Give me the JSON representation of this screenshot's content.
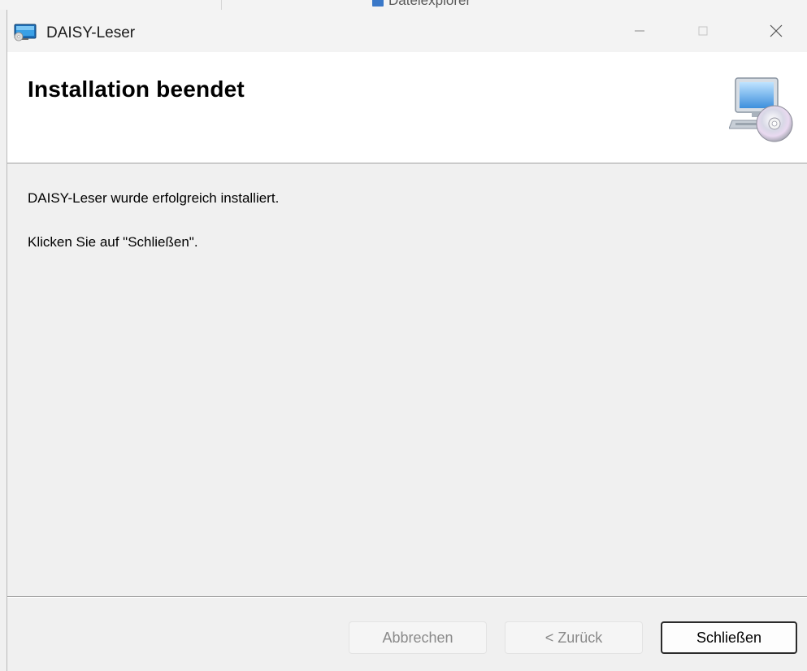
{
  "background_window": {
    "title_fragment": "Dateiexplorer"
  },
  "window": {
    "title": "DAISY-Leser",
    "controls": {
      "minimize_icon": "minimize-icon",
      "maximize_icon": "maximize-icon",
      "close_icon": "close-icon"
    }
  },
  "header": {
    "title": "Installation beendet",
    "icon": "computer-cd-icon"
  },
  "body": {
    "lines": [
      "DAISY-Leser wurde erfolgreich installiert.",
      "Klicken Sie auf \"Schließen\"."
    ]
  },
  "buttons": {
    "cancel_label": "Abbrechen",
    "back_label": "< Zurück",
    "close_label": "Schließen"
  },
  "colors": {
    "dialog_bg": "#f0f0f0",
    "header_bg": "#ffffff",
    "disabled_text": "#8a8a8a",
    "default_button_border": "#2b2b2b"
  }
}
